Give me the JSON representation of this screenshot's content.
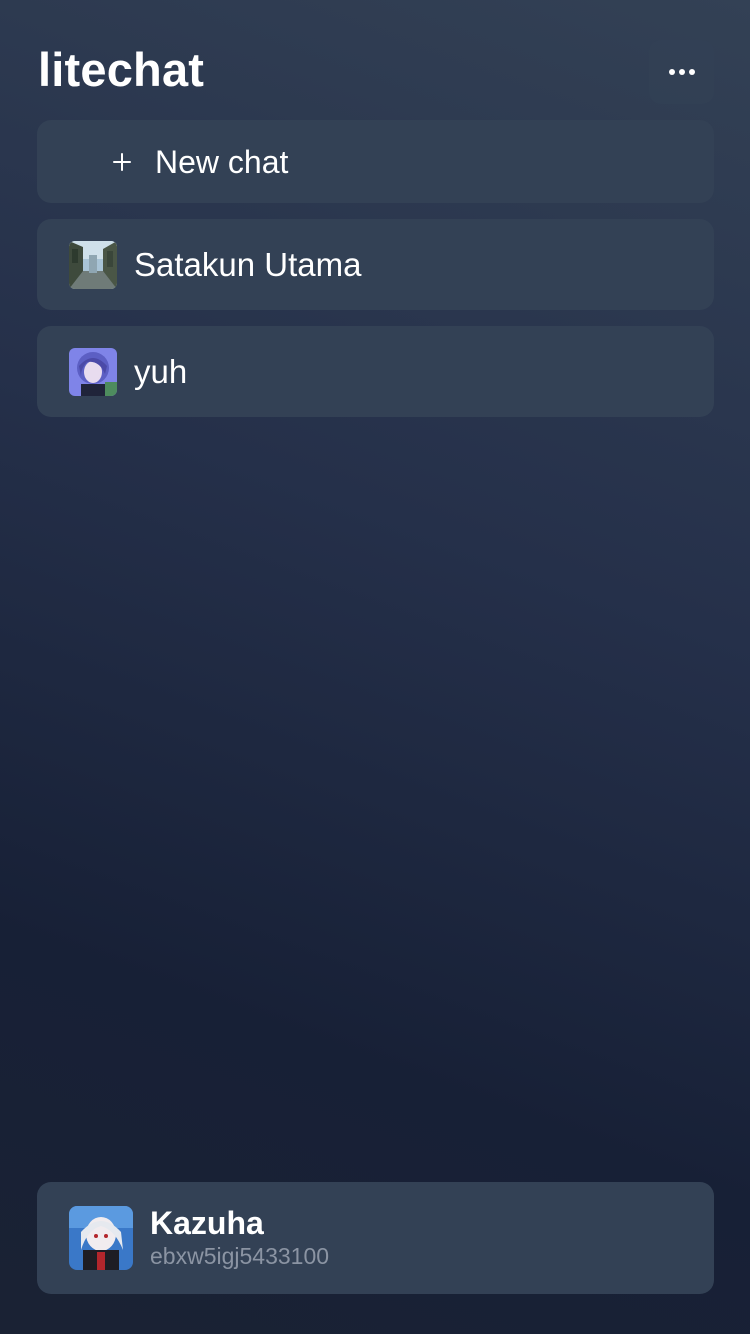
{
  "app": {
    "title": "litechat"
  },
  "header": {
    "menu_icon": "more-horizontal-icon"
  },
  "new_chat": {
    "icon": "plus-icon",
    "label": "New chat"
  },
  "chats": [
    {
      "name": "Satakun Utama",
      "avatar": "street-photo-avatar"
    },
    {
      "name": "yuh",
      "avatar": "anime-character-avatar"
    }
  ],
  "profile": {
    "name": "Kazuha",
    "id": "ebxw5igj5433100",
    "avatar": "anime-character-avatar"
  },
  "colors": {
    "card_background": "#334155",
    "background_top": "#334155",
    "background_bottom": "#172036",
    "secondary_text": "#8b94a3"
  }
}
